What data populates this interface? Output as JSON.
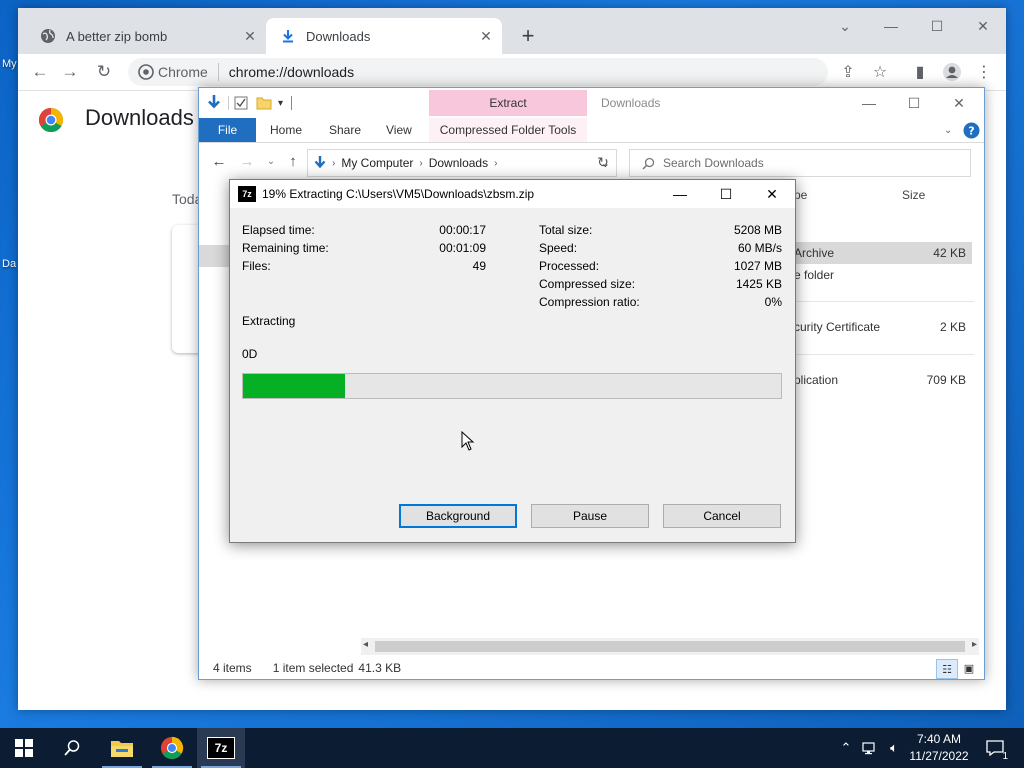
{
  "desktop": {
    "label_my": "My",
    "label_da": "Da"
  },
  "chrome": {
    "tabs": [
      {
        "title": "A better zip bomb",
        "icon": "globe-icon",
        "active": false
      },
      {
        "title": "Downloads",
        "icon": "download-icon",
        "active": true
      }
    ],
    "omnibox": {
      "chip": "Chrome",
      "url": "chrome://downloads"
    },
    "page": {
      "title": "Downloads",
      "section_today": "Toda"
    }
  },
  "explorer": {
    "title": "Downloads",
    "ribbon": {
      "contextual_header": "Extract",
      "tabs": [
        "File",
        "Home",
        "Share",
        "View",
        "Compressed Folder Tools"
      ]
    },
    "address": {
      "crumbs": [
        "My Computer",
        "Downloads"
      ]
    },
    "search": {
      "placeholder": "Search Downloads"
    },
    "columns": {
      "type": "pe",
      "size": "Size"
    },
    "rows": [
      {
        "type": " Archive",
        "size": "42 KB",
        "selected": true
      },
      {
        "type": "e folder",
        "size": "",
        "selected": false
      },
      {
        "type": "curity Certificate",
        "size": "2 KB",
        "selected": false
      },
      {
        "type": "plication",
        "size": "709 KB",
        "selected": false
      }
    ],
    "status": {
      "items": "4 items",
      "selected": "1 item selected",
      "size": "41.3 KB"
    }
  },
  "dialog": {
    "title": "19% Extracting C:\\Users\\VM5\\Downloads\\zbsm.zip",
    "icon": "7z",
    "left_stats": [
      {
        "label": "Elapsed time:",
        "value": "00:00:17"
      },
      {
        "label": "Remaining time:",
        "value": "00:01:09"
      },
      {
        "label": "Files:",
        "value": "49"
      }
    ],
    "right_stats": [
      {
        "label": "Total size:",
        "value": "5208 MB"
      },
      {
        "label": "Speed:",
        "value": "60 MB/s"
      },
      {
        "label": "Processed:",
        "value": "1027 MB"
      },
      {
        "label": "Compressed size:",
        "value": "1425 KB"
      },
      {
        "label": "Compression ratio:",
        "value": "0%"
      }
    ],
    "status_text": "Extracting",
    "current_file": "0D",
    "progress_fraction": 0.19,
    "buttons": {
      "background": "Background",
      "pause": "Pause",
      "cancel": "Cancel"
    }
  },
  "taskbar": {
    "time": "7:40 AM",
    "date": "11/27/2022",
    "notification_count": "1",
    "apps": [
      "file-explorer-icon",
      "chrome-icon",
      "7zip-icon"
    ]
  },
  "colors": {
    "progress_fill": "#06b025",
    "file_tab": "#1f6ec0",
    "extract_tab": "#f8c7dc",
    "taskbar": "#0c1c32"
  }
}
